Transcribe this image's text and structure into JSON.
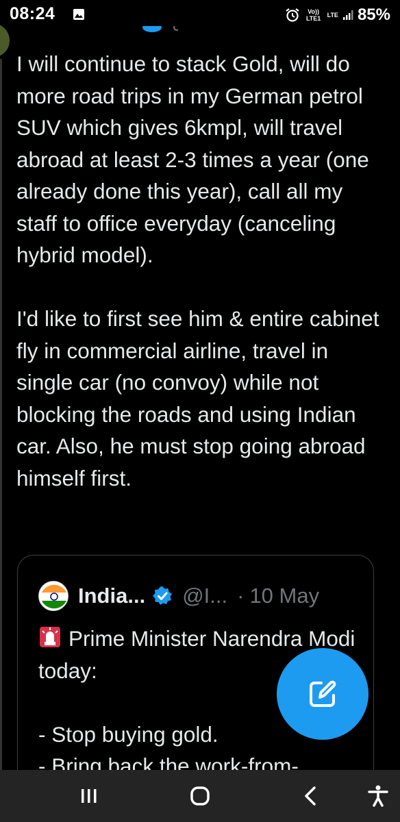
{
  "status_bar": {
    "time": "08:24",
    "battery": "85%",
    "volte_label": "Vo)) LTE1",
    "network_label": "LTE"
  },
  "tweet": {
    "paragraphs": [
      "I will continue to stack Gold, will do more road trips in my German petrol SUV which gives 6kmpl, will travel abroad at least 2-3 times a year (one already done this year), call all my staff to office everyday (canceling hybrid model).",
      "I'd like to first see him & entire cabinet fly in commercial airline, travel in single car (no convoy) while not blocking the roads and using Indian car. Also, he must stop going abroad himself first."
    ]
  },
  "quote": {
    "name": "India...",
    "handle": "@I...",
    "separator": "·",
    "date": "10 May",
    "lines": [
      "Prime Minister Narendra Modi today:",
      "",
      "- Stop buying gold.",
      "- Bring back the work-from-"
    ]
  },
  "icons": {
    "fab": "compose-icon",
    "nav_recent": "recent-apps-icon",
    "nav_home": "home-icon",
    "nav_back": "back-icon",
    "nav_accessibility": "accessibility-icon"
  },
  "colors": {
    "accent": "#1d9bf0",
    "background": "#000000",
    "text": "#e7e9ea",
    "muted": "#71767b",
    "navbar": "#242424"
  }
}
